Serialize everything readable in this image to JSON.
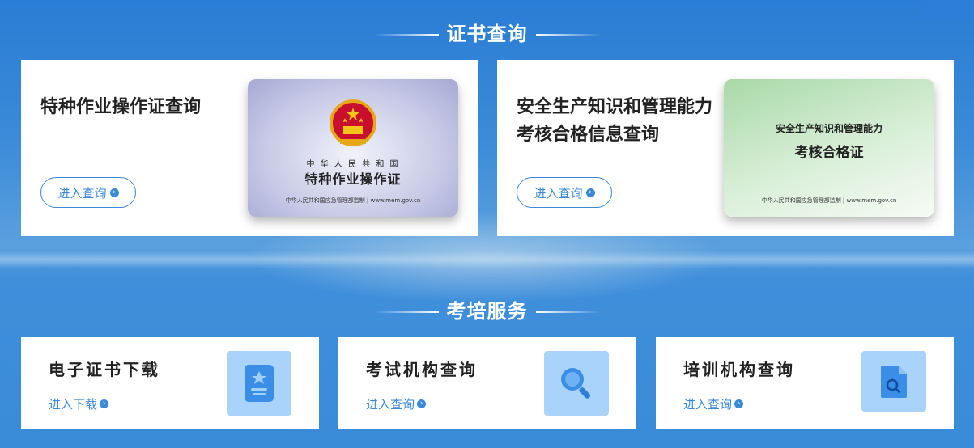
{
  "sections": {
    "certificate_query": {
      "title": "证书查询",
      "card1": {
        "title": "特种作业操作证查询",
        "button": "进入查询",
        "cert_top": "中 华 人 民 共 和 国",
        "cert_name": "特种作业操作证",
        "cert_footer": "中华人民共和国应急管理部监制  |  www.mem.gov.cn"
      },
      "card2": {
        "title_line1": "安全生产知识和管理能力",
        "title_line2": "考核合格信息查询",
        "button": "进入查询",
        "cert_top": "安全生产知识和管理能力",
        "cert_name": "考核合格证",
        "cert_footer": "中华人民共和国应急管理部监制  |  www.mem.gov.cn"
      }
    },
    "training_service": {
      "title": "考培服务",
      "items": [
        {
          "title": "电子证书下载",
          "link": "进入下载",
          "icon": "certificate-download-icon"
        },
        {
          "title": "考试机构查询",
          "link": "进入查询",
          "icon": "magnifier-icon"
        },
        {
          "title": "培训机构查询",
          "link": "进入查询",
          "icon": "document-search-icon"
        }
      ]
    }
  },
  "colors": {
    "accent": "#3a8ad8",
    "tile": "#a9d3fa",
    "background": "#3b8bd6"
  },
  "arrow_glyph": "›"
}
